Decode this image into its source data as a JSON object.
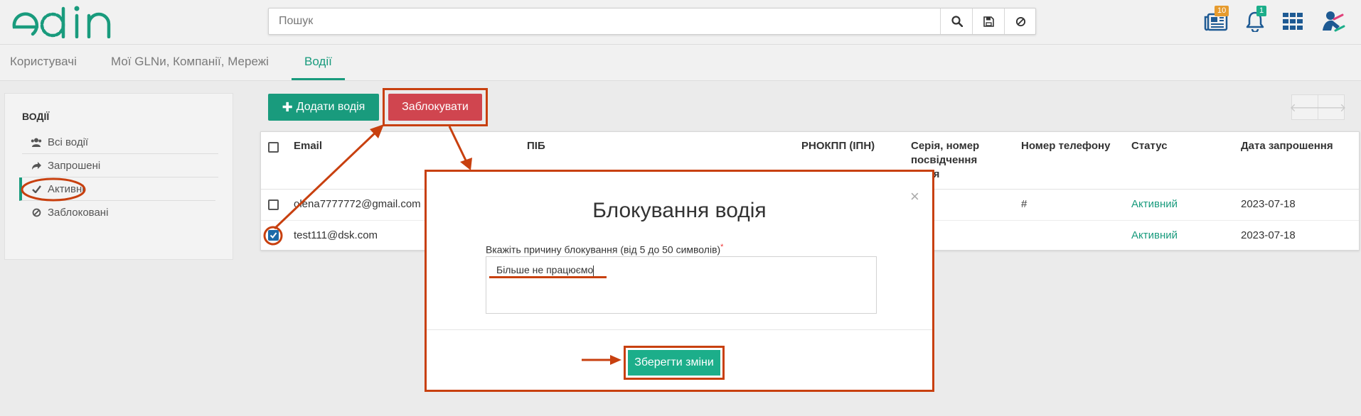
{
  "header": {
    "logo_text": "edin",
    "search_placeholder": "Пошук",
    "news_badge": "10",
    "notifications_badge": "1"
  },
  "tabs": [
    {
      "label": "Користувачі",
      "active": false
    },
    {
      "label": "Мої GLNи, Компанії, Мережі",
      "active": false
    },
    {
      "label": "Водії",
      "active": true
    }
  ],
  "sidebar": {
    "title": "ВОДІЇ",
    "items": [
      {
        "label": "Всі водії",
        "icon": "users-icon"
      },
      {
        "label": "Запрошені",
        "icon": "share-icon"
      },
      {
        "label": "Активні",
        "icon": "check-icon",
        "active": true
      },
      {
        "label": "Заблоковані",
        "icon": "ban-icon"
      }
    ]
  },
  "toolbar": {
    "add_label": "Додати водія",
    "block_label": "Заблокувати"
  },
  "table": {
    "columns": [
      "Email",
      "ПІБ",
      "РНОКПП (ІПН)",
      "Серія, номер посвідчення водія",
      "Номер телефону",
      "Статус",
      "Дата запрошення"
    ],
    "rows": [
      {
        "email": "olena7777772@gmail.com",
        "pib": "",
        "rnokpp": "",
        "series": "",
        "phone": "#",
        "status": "Активний",
        "date": "2023-07-18",
        "checked": false
      },
      {
        "email": "test111@dsk.com",
        "pib": "",
        "rnokpp": "",
        "series": "",
        "phone": "",
        "status": "Активний",
        "date": "2023-07-18",
        "checked": true
      }
    ]
  },
  "modal": {
    "title": "Блокування водія",
    "close": "×",
    "field_label": "Вкажіть причину блокування (від 5 до 50 символів)",
    "required_mark": "*",
    "field_value": "Більше не працюємо",
    "save_label": "Зберегти зміни"
  },
  "colors": {
    "brand": "#199b7d",
    "danger": "#d0454f",
    "annotation": "#c8400f"
  }
}
